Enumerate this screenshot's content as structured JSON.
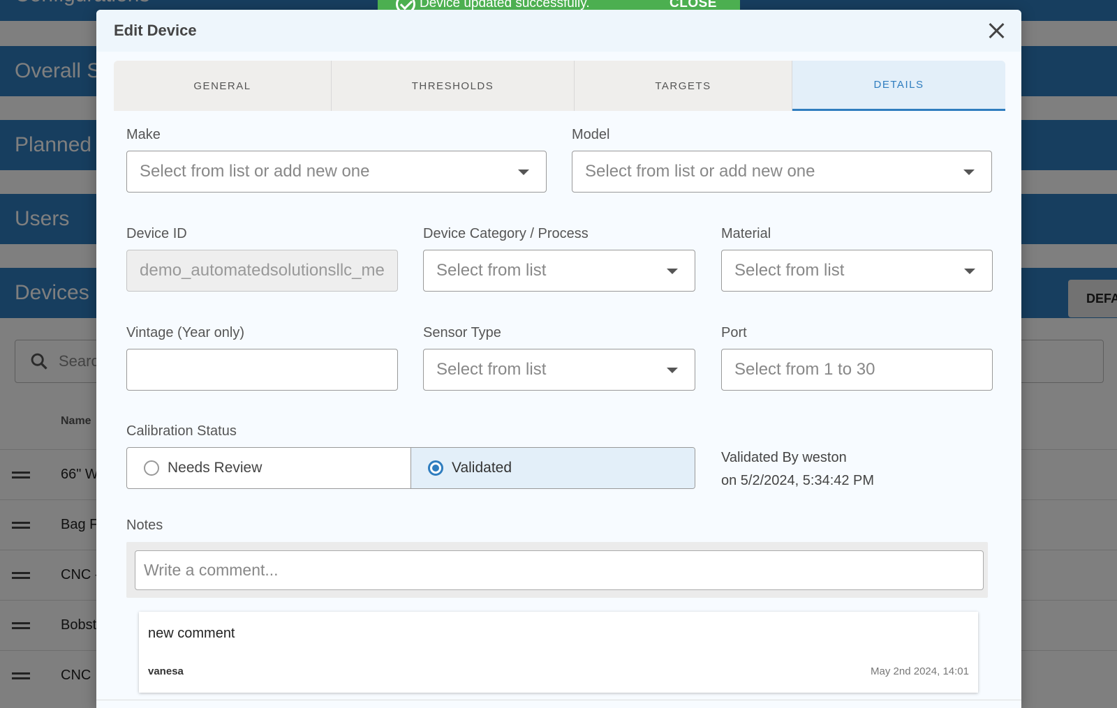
{
  "background": {
    "top_bar": "Configurations",
    "bars": [
      "Overall S",
      "Planned",
      "Users",
      "Devices"
    ],
    "search_placeholder": "Search",
    "default_button": "DEFA",
    "table_header_name": "Name",
    "rows": [
      "66\" W",
      "Bag F",
      "CNC -",
      "Bobst",
      "CNC"
    ]
  },
  "snackbar": {
    "message": "Device updated successfully.",
    "close_label": "CLOSE"
  },
  "dialog": {
    "title": "Edit Device",
    "tabs": [
      {
        "label": "GENERAL",
        "active": false
      },
      {
        "label": "THRESHOLDS",
        "active": false
      },
      {
        "label": "TARGETS",
        "active": false
      },
      {
        "label": "DETAILS",
        "active": true
      }
    ],
    "fields": {
      "make": {
        "label": "Make",
        "placeholder": "Select from list or add new one"
      },
      "model": {
        "label": "Model",
        "placeholder": "Select from list or add new one"
      },
      "device_id": {
        "label": "Device ID",
        "value": "demo_automatedsolutionsllc_me"
      },
      "category": {
        "label": "Device Category / Process",
        "placeholder": "Select from list"
      },
      "material": {
        "label": "Material",
        "placeholder": "Select from list"
      },
      "vintage": {
        "label": "Vintage (Year only)",
        "value": ""
      },
      "sensor_type": {
        "label": "Sensor Type",
        "placeholder": "Select from list"
      },
      "port": {
        "label": "Port",
        "placeholder": "Select from 1 to 30"
      }
    },
    "calibration": {
      "label": "Calibration Status",
      "options": [
        {
          "label": "Needs Review",
          "selected": false
        },
        {
          "label": "Validated",
          "selected": true
        }
      ],
      "validated_by": "Validated By weston",
      "validated_on": "on 5/2/2024, 5:34:42 PM"
    },
    "notes": {
      "label": "Notes",
      "placeholder": "Write a comment...",
      "comments": [
        {
          "text": "new comment",
          "author": "vanesa",
          "date": "May 2nd 2024, 14:01"
        }
      ]
    }
  },
  "colors": {
    "primary": "#2f7dbf",
    "success": "#4caf50",
    "selected_bg": "#e3eff9"
  }
}
